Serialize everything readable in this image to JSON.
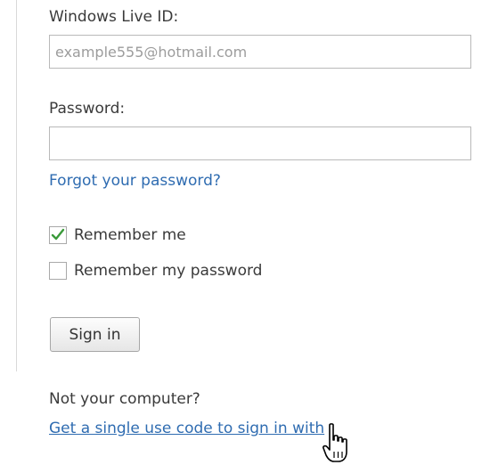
{
  "login": {
    "live_id_label": "Windows Live ID:",
    "live_id_placeholder": "example555@hotmail.com",
    "live_id_value": "",
    "password_label": "Password:",
    "password_value": "",
    "forgot_link": "Forgot your password?",
    "remember_me": {
      "label": "Remember me",
      "checked": true
    },
    "remember_password": {
      "label": "Remember my password",
      "checked": false
    },
    "sign_in_button": "Sign in",
    "not_your_computer": "Not your computer?",
    "single_use_code_link": "Get a single use code to sign in with"
  },
  "colors": {
    "link": "#2f6cb1",
    "checkmark": "#3a9a3a",
    "input_border": "#b9b9b9"
  },
  "icons": {
    "checkmark": "checkmark-icon",
    "cursor": "hand-pointer-cursor-icon"
  }
}
